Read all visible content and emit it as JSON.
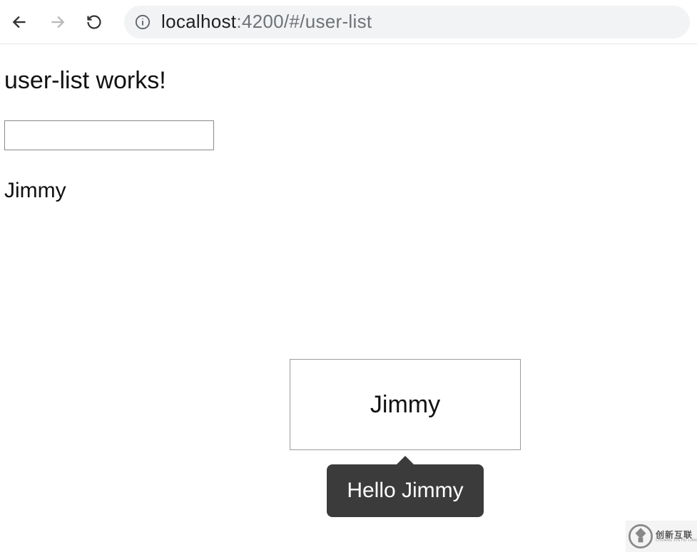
{
  "browser": {
    "url_host": "localhost",
    "url_rest": ":4200/#/user-list"
  },
  "page": {
    "heading": "user-list works!",
    "input_value": "",
    "user_name": "Jimmy"
  },
  "card": {
    "title": "Jimmy",
    "tooltip": "Hello Jimmy"
  },
  "watermark": {
    "cn": "创新互联",
    "en": "CHUANG XIN HU LIAN"
  }
}
